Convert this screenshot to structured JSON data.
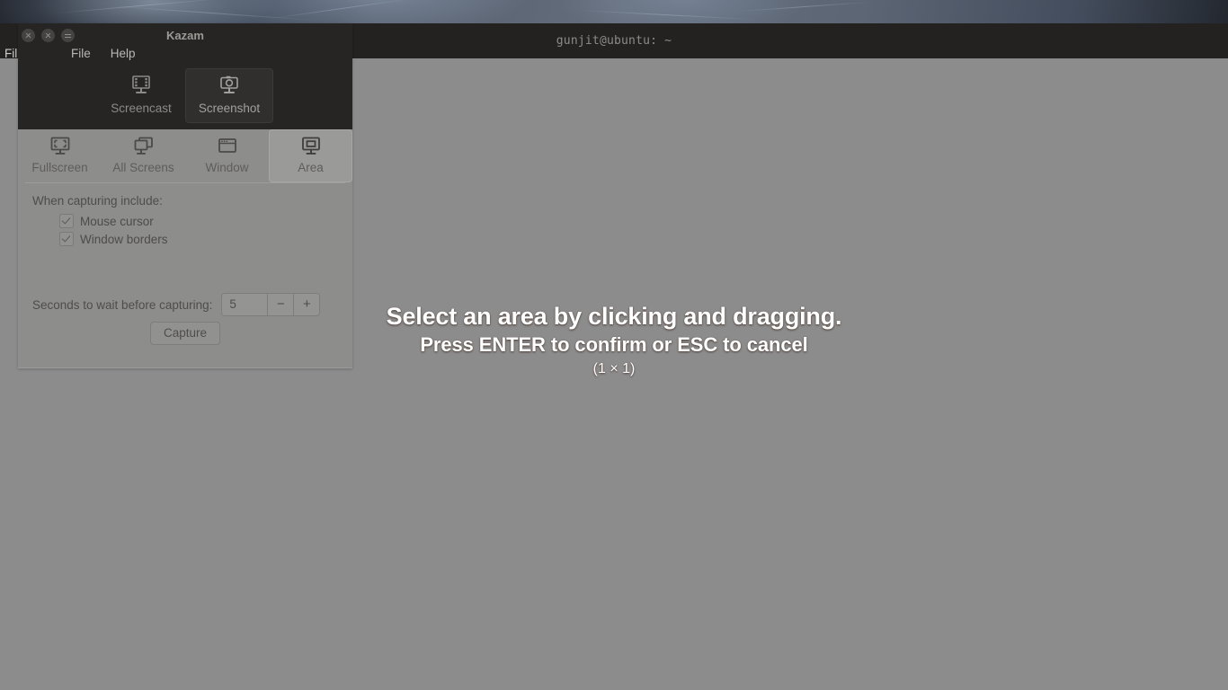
{
  "desktop": {
    "terminal": {
      "title": "gunjit@ubuntu: ~",
      "menu_clipped": "Fil",
      "prompt_text": "gu"
    }
  },
  "overlay": {
    "line1": "Select an area by clicking and dragging.",
    "line2": "Press ENTER to confirm or ESC to cancel",
    "line3": "(1 × 1)",
    "background_color": "#8c8c8c",
    "text_color": "#ffffff"
  },
  "kazam": {
    "title": "Kazam",
    "window_buttons": [
      {
        "name": "close",
        "label": ""
      },
      {
        "name": "minimize",
        "label": ""
      },
      {
        "name": "maximize",
        "label": ""
      }
    ],
    "menu": [
      {
        "label": "File"
      },
      {
        "label": "Help"
      }
    ],
    "modes": [
      {
        "label": "Screencast",
        "icon": "film-strip-icon",
        "active": false
      },
      {
        "label": "Screenshot",
        "icon": "camera-icon",
        "active": true
      }
    ],
    "tabs": [
      {
        "label": "Fullscreen",
        "icon": "fullscreen-icon",
        "active": false
      },
      {
        "label": "All Screens",
        "icon": "all-screens-icon",
        "active": false
      },
      {
        "label": "Window",
        "icon": "window-icon",
        "active": false
      },
      {
        "label": "Area",
        "icon": "area-icon",
        "active": true
      }
    ],
    "options": {
      "title": "When capturing include:",
      "items": [
        {
          "label": "Mouse cursor",
          "checked": true
        },
        {
          "label": "Window borders",
          "checked": true
        }
      ]
    },
    "delay": {
      "label": "Seconds to wait before capturing:",
      "value": "5",
      "decrement_label": "−",
      "increment_label": "+"
    },
    "capture_button": "Capture"
  }
}
